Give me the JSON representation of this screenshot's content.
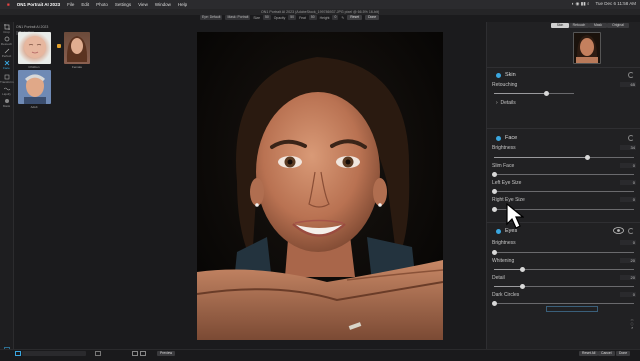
{
  "menubar": {
    "app_name": "ON1 Portrait AI 2023",
    "items": [
      "File",
      "Edit",
      "Photo",
      "Settings",
      "View",
      "Window",
      "Help"
    ],
    "clock": "Tue Dec 6 11:58 AM"
  },
  "titlebar": {
    "text": "ON1 Portrait AI 2023 (AdobeStock_199786937.JPG pixel @ 66.5% 16-bit)"
  },
  "toolbar": {
    "mode_label": "Eye: Default",
    "mode2_label": "Mask: Portrait",
    "size_label": "Size",
    "size_value": "50",
    "opacity_label": "Opacity",
    "opacity_value": "50",
    "feather_label": "Feat",
    "feather_value": "50",
    "height_label": "Height",
    "height_value": "0",
    "reset_label": "Reset",
    "done_label": "Done"
  },
  "left_tools": [
    "Crop",
    "Retouch",
    "Perfect",
    "Face",
    "Transform",
    "Liquify",
    "Mask"
  ],
  "browser": {
    "header": "ON1 Portrait AI 2023",
    "tab_label": "Portraits",
    "thumbs": [
      {
        "label": "Children"
      },
      {
        "label": "Female"
      },
      {
        "label": "Adult"
      }
    ]
  },
  "right_panel": {
    "view_tabs": [
      "Skin",
      "Retouch",
      "Mask",
      "Original"
    ],
    "skin": {
      "title": "Skin",
      "retouching_label": "Retouching",
      "retouching_value": "65",
      "details_label": "Details"
    },
    "face": {
      "title": "Face",
      "brightness_label": "Brightness",
      "brightness_value": "34",
      "slim_label": "Slim Face",
      "slim_value": "0",
      "left_eye_label": "Left Eye Size",
      "left_eye_value": "0",
      "right_eye_label": "Right Eye Size",
      "right_eye_value": "0"
    },
    "eyes": {
      "title": "Eyes",
      "brightness_label": "Brightness",
      "brightness_value": "0",
      "whitening_label": "Whitening",
      "whitening_value": "20",
      "detail_label": "Detail",
      "detail_value": "20",
      "dark_circles_label": "Dark Circles",
      "dark_circles_value": "0"
    },
    "slider_levels": {
      "retouching": 0.65,
      "face_brightness": 0.67,
      "slim_face": 0.0,
      "left_eye": 0.0,
      "right_eye": 0.0,
      "eyes_brightness": 0.0,
      "whitening": 0.2,
      "detail": 0.2,
      "dark_circles": 0.0
    }
  },
  "bottom": {
    "preview_label": "Preview",
    "reset_all_label": "Reset All",
    "cancel_label": "Cancel",
    "done_label": "Done"
  },
  "colors": {
    "accent": "#3aa7e0",
    "panel": "#212123",
    "background": "#1b1b1d"
  }
}
